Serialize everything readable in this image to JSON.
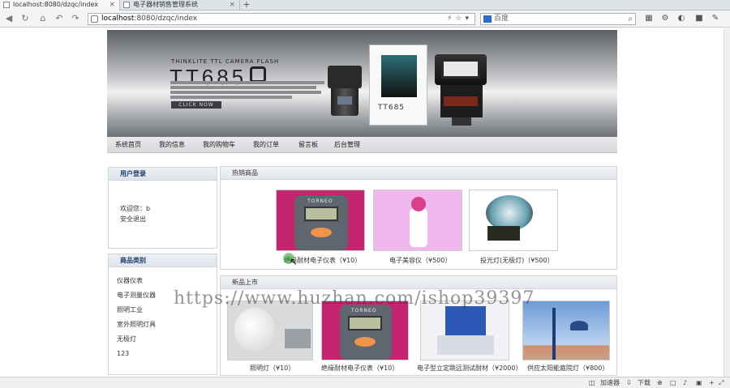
{
  "browser": {
    "tabs": [
      {
        "title": "localhost:8080/dzqc/index"
      },
      {
        "title": "电子器材销售管理系统"
      }
    ],
    "new_tab": "+",
    "url": {
      "host": "localhost",
      "path": ":8080/dzqc/index"
    },
    "search_placeholder": "百度",
    "status": {
      "accelerator": "加速器",
      "download": "下载"
    }
  },
  "banner": {
    "subtitle": "THINKLITE TTL CAMERA FLASH",
    "title": "TT685",
    "button": "CLICK NOW",
    "box_text": "TT685"
  },
  "nav": {
    "items": [
      "系统首页",
      "我的信息",
      "我的购物车",
      "我的订单",
      "留言板",
      "后台管理"
    ]
  },
  "sidebar": {
    "login": {
      "title": "用户登录",
      "welcome": "欢迎您：b",
      "logout": "安全退出"
    },
    "categories": {
      "title": "商品类别",
      "items": [
        "仪器仪表",
        "电子测量仪器",
        "照明工业",
        "室外照明灯具",
        "无极灯",
        "123"
      ]
    }
  },
  "hot": {
    "title": "热销商品",
    "items": [
      {
        "caption": "绝缘耐材电子仪表（¥10）",
        "device_logo": "TORNEO"
      },
      {
        "caption": "电子美容仪（¥500）"
      },
      {
        "caption": "投光灯(无极灯)（¥500）"
      }
    ]
  },
  "new": {
    "title": "新品上市",
    "items": [
      {
        "caption": "照明灯（¥10）"
      },
      {
        "caption": "绝缘耐材电子仪表（¥10）",
        "device_logo": "TORNEO"
      },
      {
        "caption": "电子型立定跳远测试耐材（¥2000）"
      },
      {
        "caption": "供应太阳能庭院灯（¥800）"
      }
    ]
  },
  "watermark": "https://www.huzhan.com/ishop39397"
}
